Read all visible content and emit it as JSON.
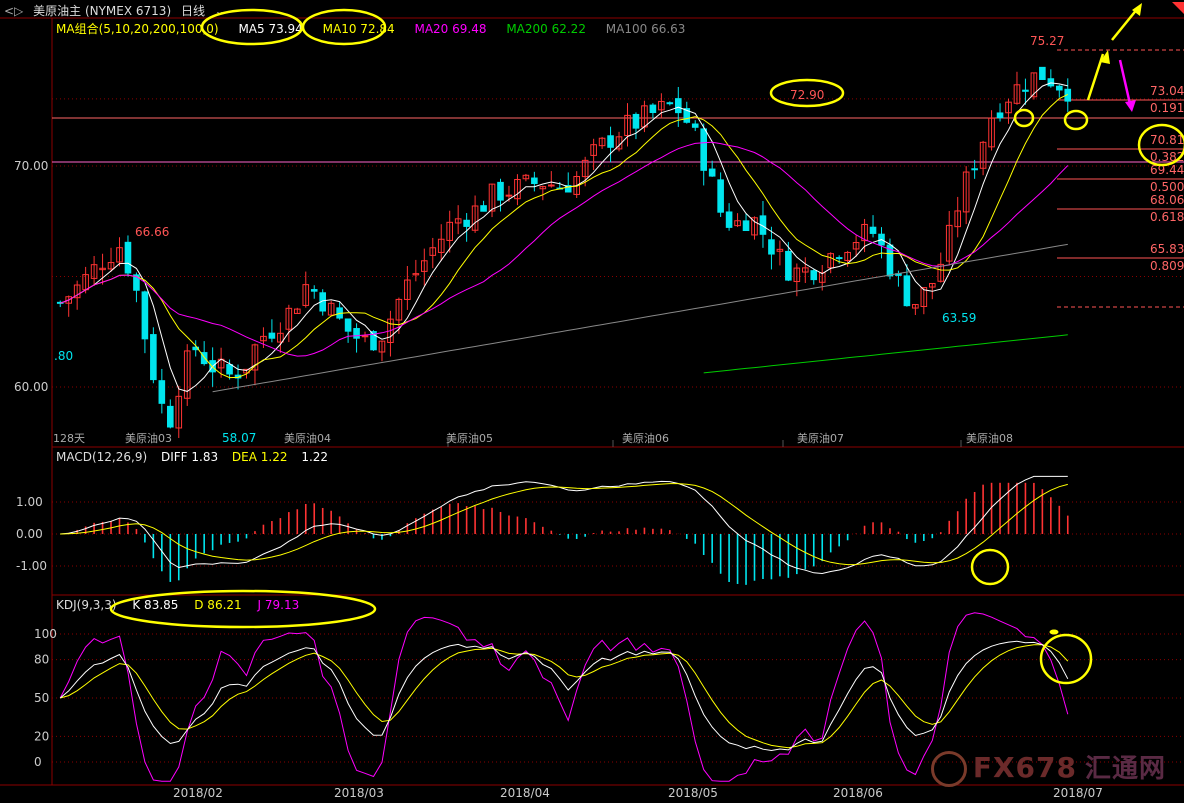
{
  "header": {
    "back_icon": "back-arrows-icon",
    "title": "美原油主 (NYMEX 6713)",
    "period": "日线",
    "period_icon": "chevron-down-icon"
  },
  "ma_legend": {
    "label": "MA组合(5,10,20,200,100,0)",
    "items": [
      {
        "label": "MA5 73.94",
        "color": "#ffffff"
      },
      {
        "label": "MA10 72.84",
        "color": "#ffff00"
      },
      {
        "label": "MA20 69.48",
        "color": "#ff00ff"
      },
      {
        "label": "MA200 62.22",
        "color": "#00cc00"
      },
      {
        "label": "MA100 66.63",
        "color": "#888888"
      }
    ]
  },
  "macd_legend": {
    "label": "MACD(12,26,9)",
    "diff": "DIFF 1.83",
    "dea": "DEA 1.22",
    "macd": "1.22"
  },
  "kdj_legend": {
    "label": "KDJ(9,3,3)",
    "k": "K 83.85",
    "d": "D 86.21",
    "j": "J 79.13"
  },
  "price_axis": {
    "ticks": [
      "70.00",
      "60.00"
    ]
  },
  "macd_axis": {
    "ticks": [
      "1.00",
      "0.00",
      "-1.00"
    ]
  },
  "kdj_axis": {
    "ticks": [
      "100",
      "80",
      "50",
      "20",
      "0"
    ]
  },
  "date_axis": {
    "labels": [
      "2018/02",
      "2018/03",
      "2018/04",
      "2018/05",
      "2018/06",
      "2018/07"
    ]
  },
  "contract_labels": [
    "128天",
    "美原油03",
    "美原油04",
    "美原油05",
    "美原油06",
    "美原油07",
    "美原油08"
  ],
  "annotations": {
    "peak_high": "75.27",
    "mid_high": "72.90",
    "left_high": "66.66",
    "low_feb": "58.07",
    "low_jun": "63.59",
    "left_edge": ".80"
  },
  "fib_levels": [
    {
      "price": "73.04",
      "ratio": "0.191"
    },
    {
      "price": "70.81",
      "ratio": "0.382"
    },
    {
      "price": "69.44",
      "ratio": "0.500"
    },
    {
      "price": "68.06",
      "ratio": "0.618"
    },
    {
      "price": "65.83",
      "ratio": "0.809"
    }
  ],
  "watermark": {
    "text": "FX678",
    "cn": "汇通网"
  },
  "colors": {
    "up": "#ff3333",
    "down": "#00e5ee",
    "ma5": "#ffffff",
    "ma10": "#ffff00",
    "ma20": "#ff00ff",
    "ma100": "#888888",
    "ma200": "#00cc00",
    "highlight": "#ffff00",
    "grid": "#8b0000"
  },
  "chart_data": {
    "type": "candlestick",
    "title": "美原油主 (NYMEX 6713)",
    "grid": true,
    "price_range": [
      57,
      76
    ],
    "series_closes_approx": {
      "x": [
        "2018/01 late",
        "2018/02",
        "2018/02 low",
        "2018/03",
        "2018/04",
        "2018/05",
        "2018/05 high",
        "2018/06",
        "2018/06 low",
        "2018/07"
      ],
      "values": [
        64.5,
        62.0,
        58.07,
        61.5,
        66.5,
        70.5,
        72.9,
        65.5,
        63.59,
        73.94
      ]
    },
    "moving_averages": {
      "MA5": 73.94,
      "MA10": 72.84,
      "MA20": 69.48,
      "MA200": 62.22,
      "MA100": 66.63
    },
    "fibonacci": [
      [
        73.04,
        0.191
      ],
      [
        70.81,
        0.382
      ],
      [
        69.44,
        0.5
      ],
      [
        68.06,
        0.618
      ],
      [
        65.83,
        0.809
      ]
    ],
    "highs_lows": {
      "high": 75.27,
      "high2": 72.9,
      "high3": 66.66,
      "low": 58.07,
      "low2": 63.59
    },
    "macd": {
      "DIFF": 1.83,
      "DEA": 1.22,
      "ylim": [
        -1.5,
        1.5
      ]
    },
    "kdj": {
      "K": 83.85,
      "D": 86.21,
      "J": 79.13,
      "ylim": [
        -10,
        115
      ]
    }
  }
}
